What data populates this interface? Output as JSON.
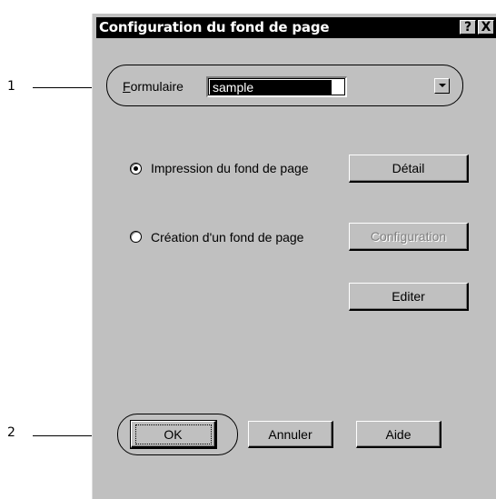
{
  "callouts": {
    "one": "1",
    "two": "2"
  },
  "dialog": {
    "title": "Configuration du fond de page",
    "help_button": "?",
    "close_button": "X"
  },
  "form": {
    "label": "Formulaire",
    "selected_value": "sample"
  },
  "options": {
    "print_overlay_label": "Impression du fond de page",
    "print_overlay_checked": true,
    "create_overlay_label": "Création d'un fond de page",
    "create_overlay_checked": false
  },
  "buttons": {
    "detail": "Détail",
    "configuration": "Configuration",
    "edit": "Editer",
    "ok": "OK",
    "cancel": "Annuler",
    "help": "Aide"
  },
  "colors": {
    "dialog_bg": "#c0c0c0",
    "titlebar_bg": "#000000",
    "title_text": "#ffffff"
  }
}
